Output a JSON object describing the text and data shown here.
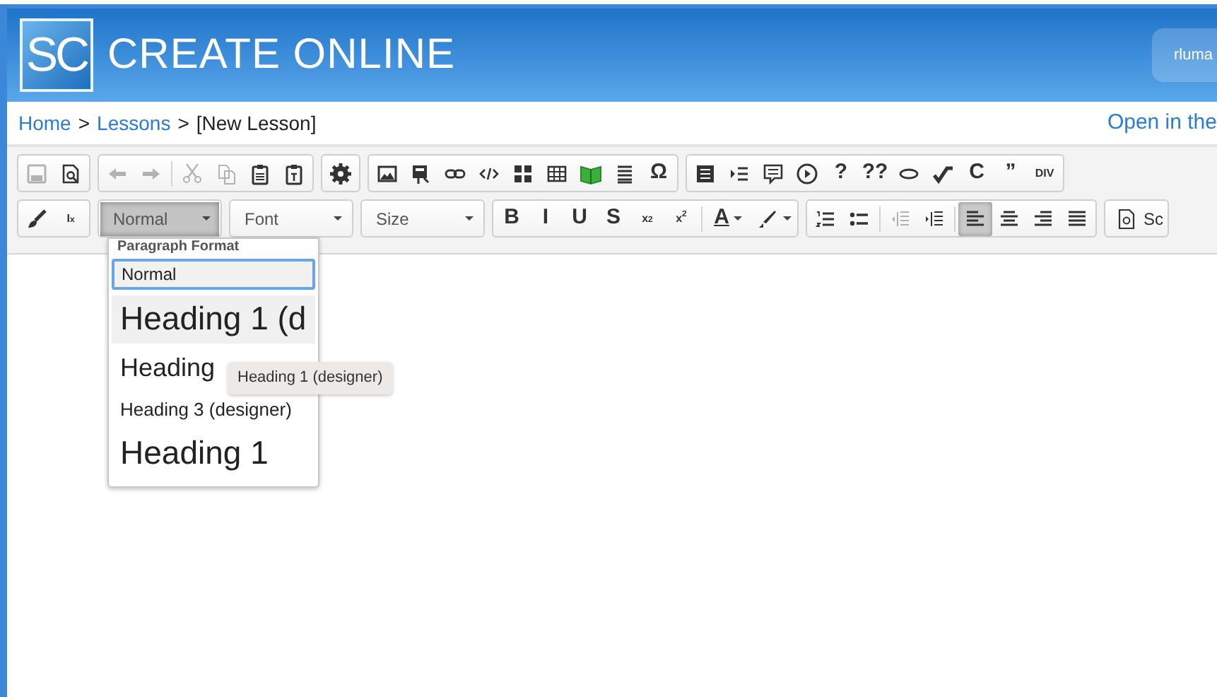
{
  "header": {
    "logo": "SC",
    "title": "CREATE ONLINE",
    "user": "rluma"
  },
  "breadcrumb": {
    "items": [
      {
        "label": "Home",
        "kind": "link"
      },
      {
        "label": "Lessons",
        "kind": "link"
      },
      {
        "label": "[New Lesson]",
        "kind": "current"
      }
    ],
    "separator": ">",
    "action": "Open in the"
  },
  "toolbar": {
    "rows": [
      {
        "groups": [
          {
            "buttons": [
              {
                "kind": "icon",
                "disabled": true
              },
              {
                "kind": "icon",
                "disabled": false
              }
            ]
          },
          {
            "buttons": [
              {
                "kind": "icon",
                "disabled": true
              },
              {
                "kind": "icon",
                "disabled": true
              },
              {
                "kind": "separator"
              },
              {
                "kind": "icon",
                "disabled": true
              },
              {
                "kind": "icon",
                "disabled": true
              },
              {
                "kind": "icon",
                "disabled": false
              },
              {
                "kind": "icon",
                "disabled": false
              }
            ]
          },
          {
            "buttons": [
              {
                "kind": "icon",
                "disabled": false
              }
            ]
          },
          {
            "buttons": [
              {
                "kind": "icon",
                "disabled": false
              },
              {
                "kind": "icon",
                "disabled": false
              },
              {
                "kind": "icon",
                "disabled": false
              },
              {
                "kind": "icon",
                "disabled": false
              },
              {
                "kind": "icon",
                "disabled": false
              },
              {
                "kind": "icon",
                "disabled": false
              },
              {
                "kind": "icon",
                "disabled": false
              },
              {
                "kind": "icon",
                "disabled": false
              },
              {
                "kind": "glyph",
                "label": "Ω"
              }
            ]
          },
          {
            "buttons": [
              {
                "kind": "icon",
                "disabled": false
              },
              {
                "kind": "icon",
                "disabled": false
              },
              {
                "kind": "icon",
                "disabled": false
              },
              {
                "kind": "icon",
                "disabled": false
              },
              {
                "kind": "glyph",
                "label": "?"
              },
              {
                "kind": "glyph",
                "label": "??"
              },
              {
                "kind": "icon",
                "disabled": false
              },
              {
                "kind": "icon",
                "disabled": false
              },
              {
                "kind": "glyph",
                "label": "C"
              },
              {
                "kind": "glyph",
                "label": "”"
              },
              {
                "kind": "glyph",
                "label": "DIV"
              }
            ]
          }
        ]
      },
      {
        "groups": [
          {
            "buttons": [
              {
                "kind": "icon",
                "disabled": false
              },
              {
                "kind": "glyph",
                "label": "I$_{x}$"
              }
            ]
          },
          {
            "buttons": [
              {
                "kind": "combo",
                "label": "Normal",
                "pressed": true
              }
            ]
          },
          {
            "buttons": [
              {
                "kind": "combo",
                "label": "Font",
                "pressed": false
              }
            ]
          },
          {
            "buttons": [
              {
                "kind": "combo",
                "label": "Size",
                "pressed": false
              }
            ]
          },
          {
            "buttons": [
              {
                "kind": "glyph",
                "label": "B"
              },
              {
                "kind": "glyph",
                "label": "I"
              },
              {
                "kind": "glyph",
                "label": "U"
              },
              {
                "kind": "glyph",
                "label": "S"
              },
              {
                "kind": "glyph",
                "label": "x$_{2}$"
              },
              {
                "kind": "glyph",
                "label": "x$^{2}$"
              },
              {
                "kind": "separator"
              },
              {
                "kind": "menu-glyph",
                "label": "A"
              },
              {
                "kind": "menu-icon"
              }
            ]
          },
          {
            "buttons": [
              {
                "kind": "icon",
                "disabled": false
              },
              {
                "kind": "icon",
                "disabled": false
              },
              {
                "kind": "separator"
              },
              {
                "kind": "icon",
                "disabled": true
              },
              {
                "kind": "icon",
                "disabled": false
              },
              {
                "kind": "separator"
              },
              {
                "kind": "icon",
                "disabled": false,
                "selected": true
              },
              {
                "kind": "icon",
                "disabled": false,
                "selected": false
              },
              {
                "kind": "icon",
                "disabled": false,
                "selected": false
              },
              {
                "kind": "icon",
                "disabled": false,
                "selected": false
              }
            ]
          },
          {
            "buttons": [
              {
                "kind": "text-button",
                "label": "Sc"
              }
            ]
          }
        ]
      }
    ]
  },
  "format_menu": {
    "title": "Paragraph Format",
    "items": [
      {
        "label": "Normal",
        "selected": true,
        "hovered": false
      },
      {
        "label": "Heading 1 (d",
        "selected": false,
        "hovered": true
      },
      {
        "label": "Heading",
        "selected": false,
        "hovered": false
      },
      {
        "label": "Heading 3 (designer)",
        "selected": false,
        "hovered": false
      },
      {
        "label": "Heading 1",
        "selected": false,
        "hovered": false
      }
    ],
    "tooltip": "Heading 1 (designer)"
  }
}
